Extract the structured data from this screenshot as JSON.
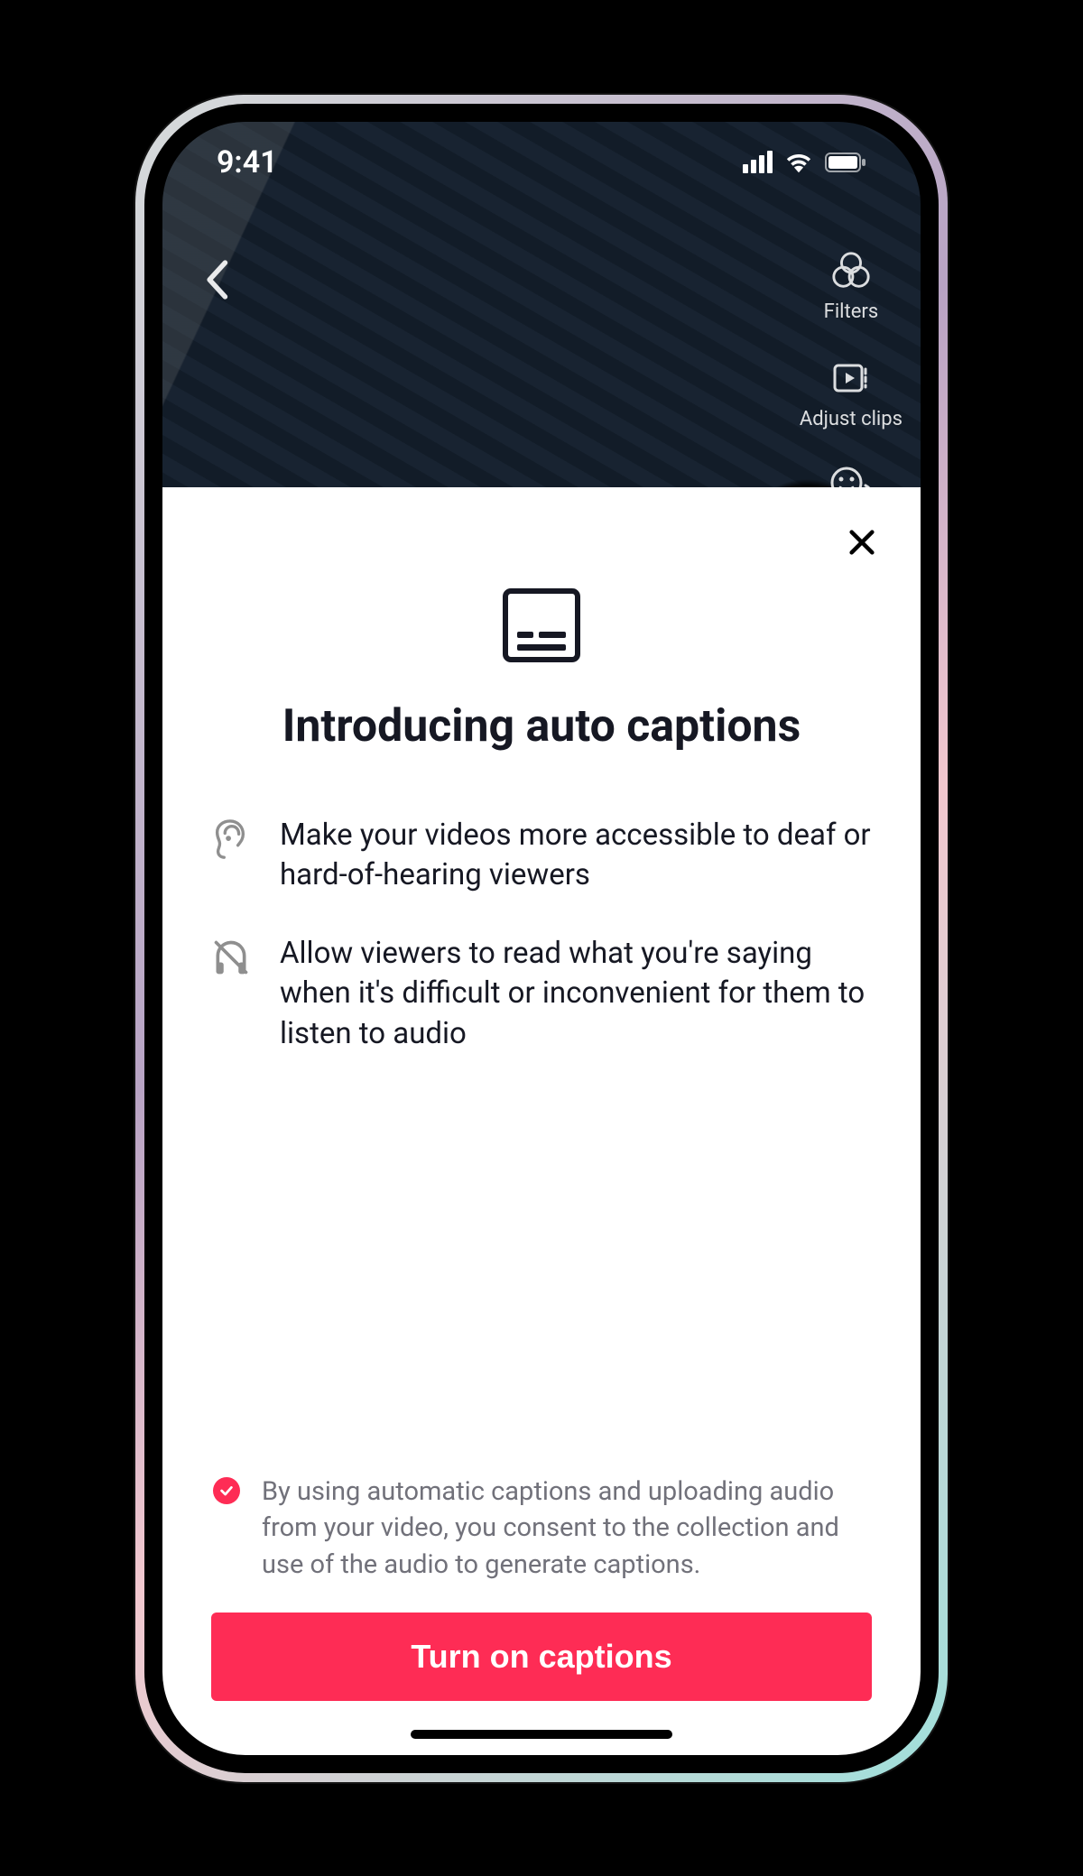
{
  "status": {
    "time": "9:41"
  },
  "video": {
    "sideTools": [
      {
        "icon": "filters-icon",
        "label": "Filters"
      },
      {
        "icon": "adjust-clips-icon",
        "label": "Adjust clips"
      },
      {
        "icon": "voice-effects-icon",
        "label": ""
      }
    ]
  },
  "sheet": {
    "title": "Introducing auto captions",
    "benefits": [
      {
        "icon": "ear-icon",
        "text": "Make your videos more accessible to deaf or hard-of-hearing viewers"
      },
      {
        "icon": "headphones-off-icon",
        "text": "Allow viewers to read what you're saying when it's difficult or inconvenient for them to listen to audio"
      }
    ],
    "consent": {
      "checked": true,
      "text": "By using automatic captions and uploading audio from your video, you consent to the collection and use of the audio to generate captions."
    },
    "cta": "Turn on captions"
  },
  "colors": {
    "accent": "#fe2c55"
  }
}
